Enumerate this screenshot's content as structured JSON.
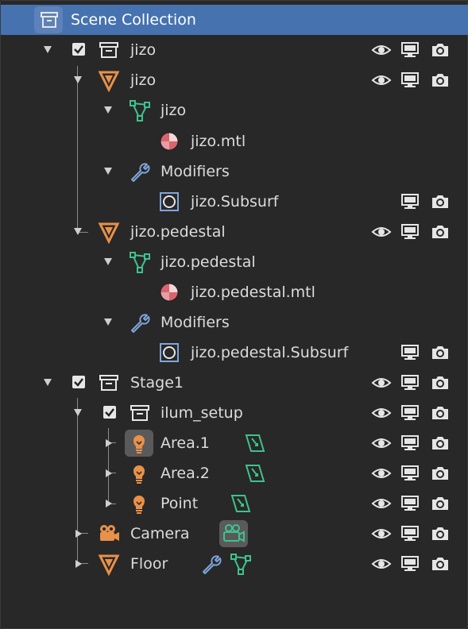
{
  "outliner": {
    "scene_collection": {
      "label": "Scene Collection",
      "icon": "scene-collection-icon"
    },
    "rows": [
      {
        "id": "jizo-collection",
        "label": "jizo",
        "icon": "collection-icon"
      },
      {
        "id": "jizo-object",
        "label": "jizo",
        "icon": "mesh-object-icon"
      },
      {
        "id": "jizo-mesh",
        "label": "jizo",
        "icon": "mesh-data-icon"
      },
      {
        "id": "jizo-material",
        "label": "jizo.mtl",
        "icon": "material-icon"
      },
      {
        "id": "jizo-modifiers",
        "label": "Modifiers",
        "icon": "wrench-icon"
      },
      {
        "id": "jizo-subsurf",
        "label": "jizo.Subsurf",
        "icon": "subsurf-modifier-icon"
      },
      {
        "id": "pedestal-object",
        "label": "jizo.pedestal",
        "icon": "mesh-object-icon"
      },
      {
        "id": "pedestal-mesh",
        "label": "jizo.pedestal",
        "icon": "mesh-data-icon"
      },
      {
        "id": "pedestal-material",
        "label": "jizo.pedestal.mtl",
        "icon": "material-icon"
      },
      {
        "id": "pedestal-modifiers",
        "label": "Modifiers",
        "icon": "wrench-icon"
      },
      {
        "id": "pedestal-subsurf",
        "label": "jizo.pedestal.Subsurf",
        "icon": "subsurf-modifier-icon"
      },
      {
        "id": "stage1-collection",
        "label": "Stage1",
        "icon": "collection-icon"
      },
      {
        "id": "ilum-setup-collection",
        "label": "ilum_setup",
        "icon": "collection-icon"
      },
      {
        "id": "area1-light",
        "label": "Area.1",
        "icon": "light-icon"
      },
      {
        "id": "area2-light",
        "label": "Area.2",
        "icon": "light-icon"
      },
      {
        "id": "point-light",
        "label": "Point",
        "icon": "light-icon"
      },
      {
        "id": "camera-object",
        "label": "Camera",
        "icon": "camera-icon"
      },
      {
        "id": "floor-object",
        "label": "Floor",
        "icon": "mesh-object-icon"
      }
    ],
    "column_icons": [
      "eye-icon",
      "monitor-icon",
      "camera-render-icon"
    ],
    "colors": {
      "selection": "#4672b0",
      "object_orange": "#e8914a",
      "mesh_green": "#3ec28f",
      "material_red": "#d9646e",
      "modifier_blue": "#7fa6dc",
      "light_orange": "#e8914a"
    }
  }
}
